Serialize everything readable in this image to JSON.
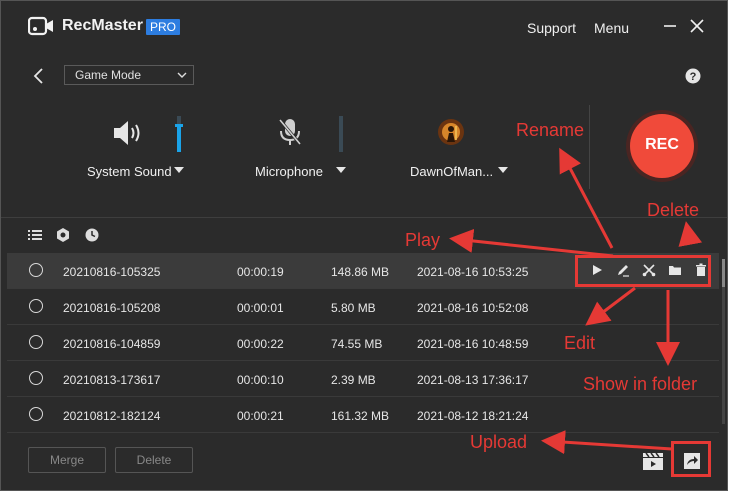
{
  "app": {
    "name": "RecMaster",
    "badge": "PRO",
    "menu_support": "Support",
    "menu_menu": "Menu"
  },
  "toolbar": {
    "mode_value": "Game Mode"
  },
  "sources": {
    "system_sound_label": "System Sound",
    "system_sound_level": 0.75,
    "microphone_label": "Microphone",
    "microphone_level": 0.0,
    "game_label": "DawnOfMan..."
  },
  "rec_label": "REC",
  "recordings": [
    {
      "name": "20210816-105325",
      "duration": "00:00:19",
      "size": "148.86 MB",
      "date": "2021-08-16 10:53:25",
      "selected": true
    },
    {
      "name": "20210816-105208",
      "duration": "00:00:01",
      "size": "5.80 MB",
      "date": "2021-08-16 10:52:08",
      "selected": false
    },
    {
      "name": "20210816-104859",
      "duration": "00:00:22",
      "size": "74.55 MB",
      "date": "2021-08-16 10:48:59",
      "selected": false
    },
    {
      "name": "20210813-173617",
      "duration": "00:00:10",
      "size": "2.39 MB",
      "date": "2021-08-13 17:36:17",
      "selected": false
    },
    {
      "name": "20210812-182124",
      "duration": "00:00:21",
      "size": "161.32 MB",
      "date": "2021-08-12 18:21:24",
      "selected": false
    }
  ],
  "footer": {
    "merge_label": "Merge",
    "delete_label": "Delete"
  },
  "annotations": {
    "rename": "Rename",
    "delete": "Delete",
    "play": "Play",
    "edit": "Edit",
    "show_in_folder": "Show in folder",
    "upload": "Upload"
  },
  "colors": {
    "accent": "#1aa3e8",
    "rec": "#f04a3a",
    "annotation": "#e53935",
    "pro_badge": "#2d7de0"
  },
  "icons": [
    "camera-logo-icon",
    "minimize-icon",
    "close-icon",
    "back-icon",
    "chevron-down-icon",
    "help-icon",
    "speaker-icon",
    "microphone-muted-icon",
    "game-avatar-icon",
    "list-icon",
    "settings-gear-icon",
    "clock-icon",
    "play-icon",
    "pen-icon",
    "scissors-icon",
    "folder-icon",
    "trash-icon",
    "clapperboard-icon",
    "share-icon"
  ]
}
